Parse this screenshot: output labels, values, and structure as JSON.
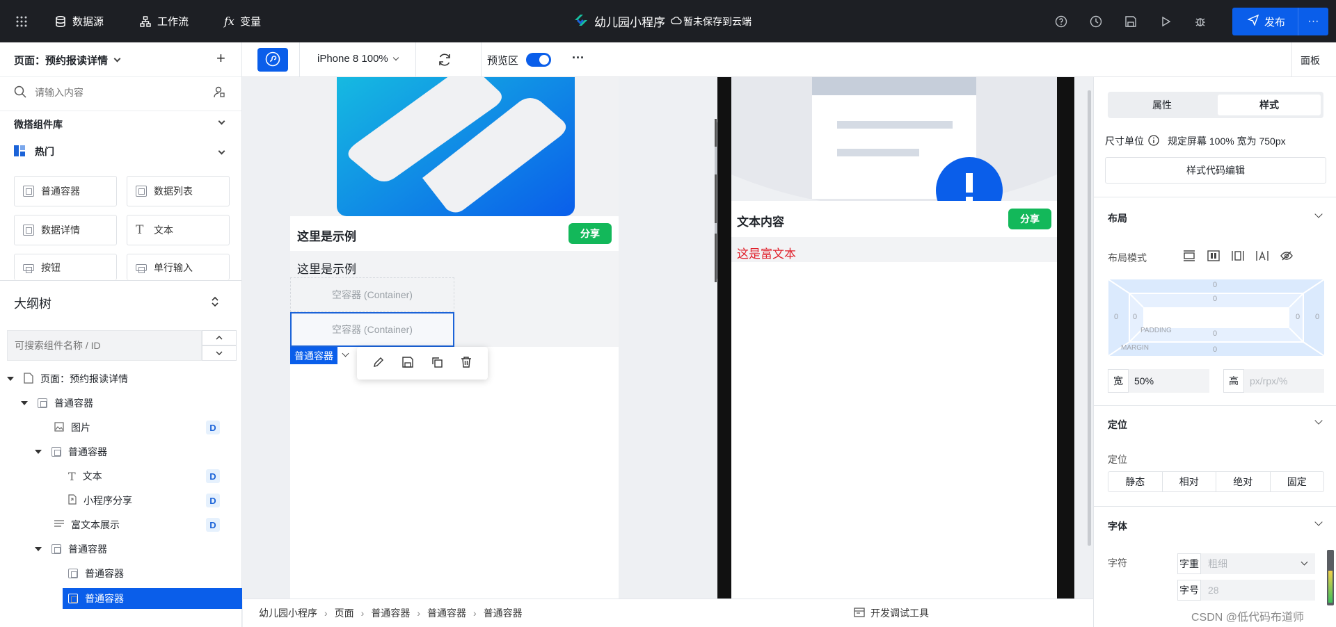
{
  "topbar": {
    "datasource": "数据源",
    "workflow": "工作流",
    "variable": "变量",
    "fx": "fx",
    "app_title": "幼儿园小程序",
    "save_status": "暂未保存到云端",
    "publish": "发布",
    "more": "···"
  },
  "toolbar": {
    "device": "iPhone 8 100%",
    "preview": "预览区",
    "more": "···",
    "panel": "面板"
  },
  "left": {
    "page_selector": "页面：预约报读详情",
    "add": "+",
    "search_placeholder": "请输入内容",
    "library_title": "微搭组件库",
    "hot_title": "热门",
    "components": [
      "普通容器",
      "数据列表",
      "数据详情",
      "文本",
      "按钮",
      "单行输入"
    ],
    "outline_title": "大纲树",
    "outline_search_placeholder": "可搜索组件名称 / ID",
    "tree": [
      {
        "label": "页面：预约报读详情",
        "badge": ""
      },
      {
        "label": "普通容器",
        "badge": ""
      },
      {
        "label": "图片",
        "badge": "D"
      },
      {
        "label": "普通容器",
        "badge": ""
      },
      {
        "label": "文本",
        "badge": "D"
      },
      {
        "label": "小程序分享",
        "badge": "D"
      },
      {
        "label": "富文本展示",
        "badge": "D"
      },
      {
        "label": "普通容器",
        "badge": ""
      },
      {
        "label": "普通容器",
        "badge": ""
      },
      {
        "label": "普通容器",
        "badge": ""
      }
    ]
  },
  "canvas": {
    "card_title": "这里是示例",
    "share": "分享",
    "body_text": "这里是示例",
    "container1": "空容器 (Container)",
    "container2": "空容器 (Container)",
    "selected_tag": "普通容器"
  },
  "phone": {
    "card_title": "文本内容",
    "share": "分享",
    "rich_text": "这是富文本"
  },
  "breadcrumb": {
    "items": [
      "幼儿园小程序",
      "页面",
      "普通容器",
      "普通容器",
      "普通容器"
    ],
    "dev_tools": "开发调试工具"
  },
  "right": {
    "tabs": [
      "属性",
      "样式"
    ],
    "unit_label": "尺寸单位",
    "unit_value": "规定屏幕 100% 宽为 750px",
    "style_code_btn": "样式代码编辑",
    "layout_title": "布局",
    "layout_mode_label": "布局模式",
    "box_values": {
      "margin_top": "0",
      "padding_top": "0",
      "left_outer": "0",
      "left_inner": "0",
      "right_inner": "0",
      "right_outer": "0",
      "padding_bottom": "0",
      "margin_bottom": "0"
    },
    "padding_label": "PADDING",
    "margin_label": "MARGIN",
    "width_label": "宽",
    "width_value": "50%",
    "height_label": "高",
    "height_placeholder": "px/rpx/%",
    "position_title": "定位",
    "position_label": "定位",
    "position_options": [
      "静态",
      "相对",
      "绝对",
      "固定"
    ],
    "font_title": "字体",
    "font_label": "字符",
    "font_weight_label": "字重",
    "font_weight_placeholder": "粗细",
    "font_size_label": "字号",
    "font_size_placeholder": "28"
  },
  "watermark": "CSDN @低代码布道师",
  "colors": {
    "accent": "#0a5eea",
    "share_green": "#13b85a",
    "topbar": "#1d1f24",
    "rich_text_red": "#e0202b"
  }
}
